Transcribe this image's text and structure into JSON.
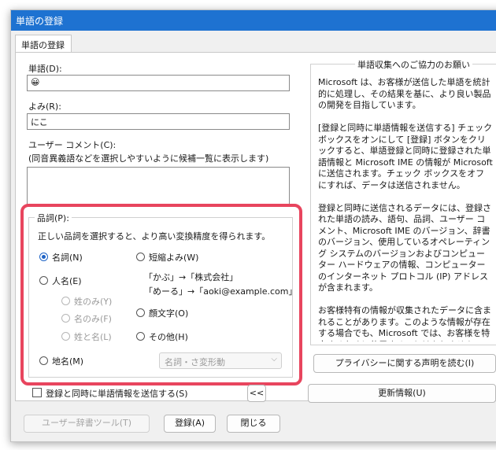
{
  "window": {
    "title": "単語の登録"
  },
  "tab": {
    "label": "単語の登録"
  },
  "word": {
    "label": "単語(D):",
    "value": "😀"
  },
  "reading": {
    "label": "よみ(R):",
    "value": "にこ"
  },
  "comment": {
    "label": "ユーザー コメント(C):",
    "hint": "(同音異義語などを選択しやすいように候補一覧に表示します)",
    "value": ""
  },
  "pos": {
    "label": "品詞(P):",
    "description": "正しい品詞を選択すると、より高い変換精度を得られます。",
    "noun": "名詞(N)",
    "person": "人名(E)",
    "surname_only": "姓のみ(Y)",
    "given_only": "名のみ(F)",
    "full_name": "姓と名(L)",
    "place": "地名(M)",
    "short": "短縮よみ(W)",
    "short_example1": "「かぶ」→「株式会社」",
    "short_example2": "「めーる」→「aoki@example.com」",
    "emoticon": "顔文字(O)",
    "other": "その他(H)",
    "subtype_select": "名詞・さ変形動"
  },
  "send_checkbox": {
    "label": "登録と同時に単語情報を送信する(S)"
  },
  "collapse_button": {
    "label": "<<"
  },
  "info": {
    "heading": "単語収集へのご協力のお願い",
    "text": "Microsoft は、お客様が送信した単語を統計的に処理し、その結果を基に、より良い製品の開発を目指しています。\n\n[登録と同時に単語情報を送信する] チェック ボックスをオンにして [登録] ボタンをクリックすると、単語登録と同時に登録された単語情報と Microsoft IME の情報が Microsoft に送信されます。チェック ボックスをオフにすれば、データは送信されません。\n\n登録と同時に送信されるデータには、登録された単語の読み、語句、品詞、ユーザー コメント、Microsoft IME のバージョン、辞書のバージョン、使用しているオペレーティング システムのバージョンおよびコンピューター ハードウェアの情報、コンピューターのインターネット プロトコル (IP) アドレスが含まれます。\n\nお客様特有の情報が収集されたデータに含まれることがあります。このような情報が存在する場合でも、Microsoft では、お客様を特定するために使用することはありません。",
    "privacy_button": "プライバシーに関する声明を読む(I)",
    "update_button": "更新情報(U)"
  },
  "footer": {
    "dictionary_tool": "ユーザー辞書ツール(T)",
    "register": "登録(A)",
    "close": "閉じる"
  },
  "colors": {
    "titlebar": "#1e72d1",
    "highlight": "#e8455e",
    "radio_selected": "#1e63c6"
  }
}
